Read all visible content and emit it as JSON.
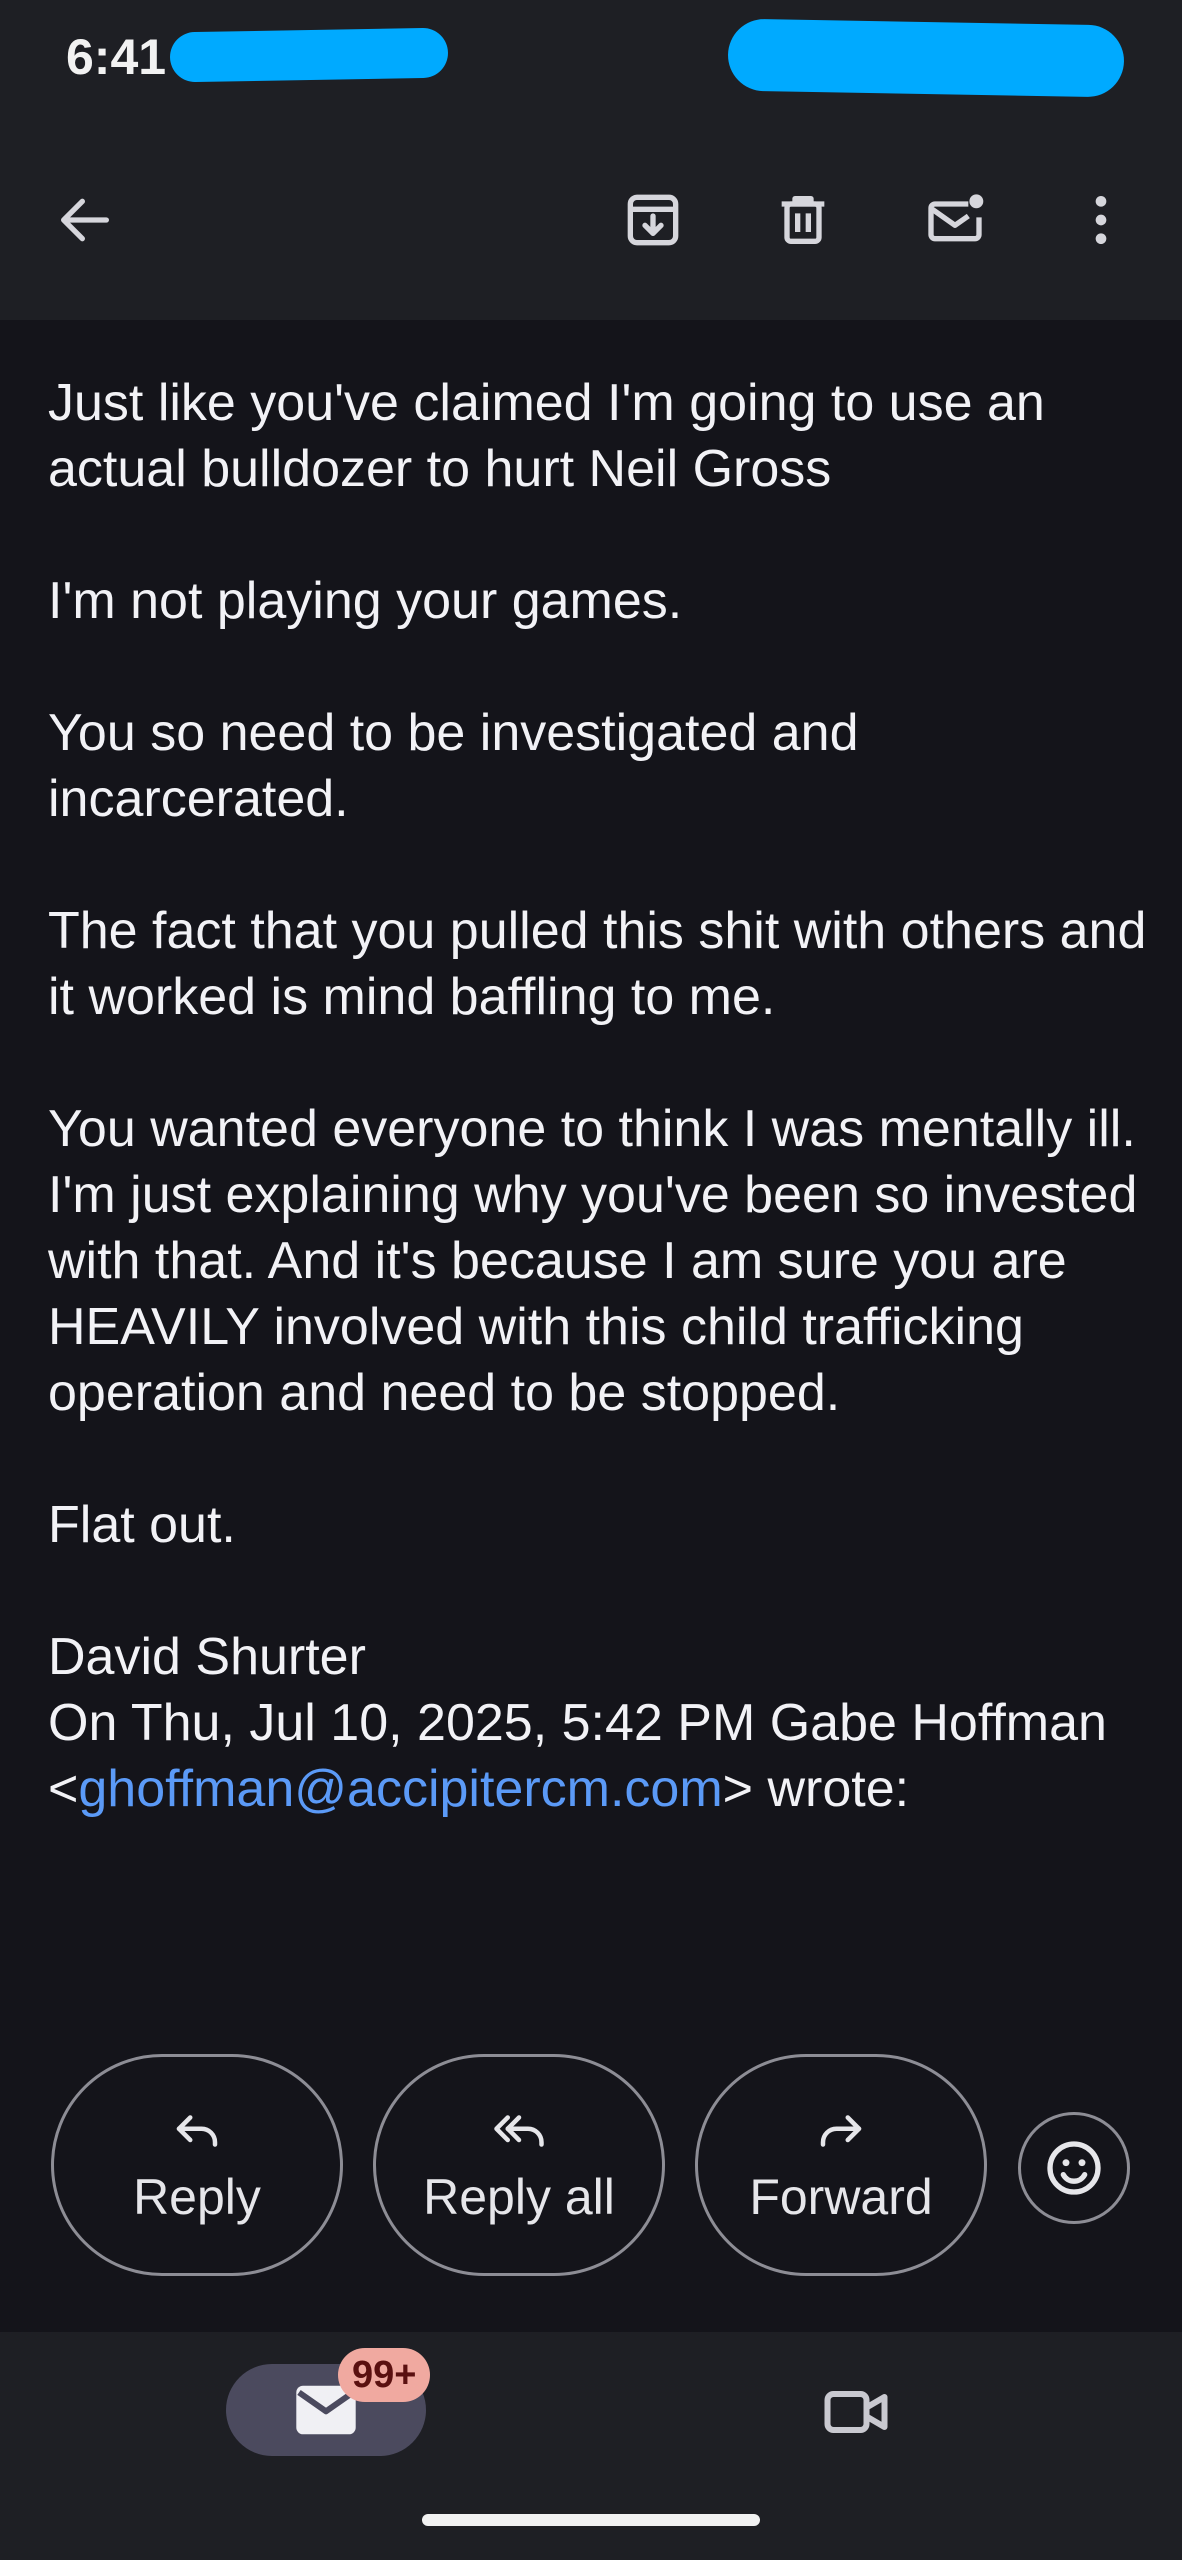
{
  "status_bar": {
    "time": "6:41"
  },
  "toolbar": {
    "back_icon": "arrow-left-icon",
    "archive_icon": "archive-icon",
    "delete_icon": "trash-icon",
    "mark_unread_icon": "mark-unread-icon",
    "more_icon": "more-vertical-icon"
  },
  "email": {
    "paragraphs": [
      "Just like you've claimed I'm going to use an actual bulldozer to hurt Neil Gross",
      "I'm not playing your games.",
      "You so need to be investigated and incarcerated.",
      "The fact that you pulled this shit with others and it worked is mind baffling to me.",
      "You wanted everyone to think I was mentally ill. I'm just explaining why you've been so invested with that. And it's because I am sure you are HEAVILY involved with this child trafficking operation and need to be stopped.",
      "Flat out."
    ],
    "signature": "David Shurter",
    "quote_prefix": "On Thu, Jul 10, 2025, 5:42 PM Gabe Hoffman <",
    "quote_email": "ghoffman@accipitercm.com",
    "quote_suffix": "> wrote:"
  },
  "actions": {
    "reply": "Reply",
    "reply_all": "Reply all",
    "forward": "Forward"
  },
  "bottom_nav": {
    "mail_badge": "99+"
  },
  "colors": {
    "background": "#14141a",
    "bar": "#1e1f24",
    "link": "#5b9af7",
    "badge": "#f0a9a0",
    "redaction": "#00aaff"
  }
}
